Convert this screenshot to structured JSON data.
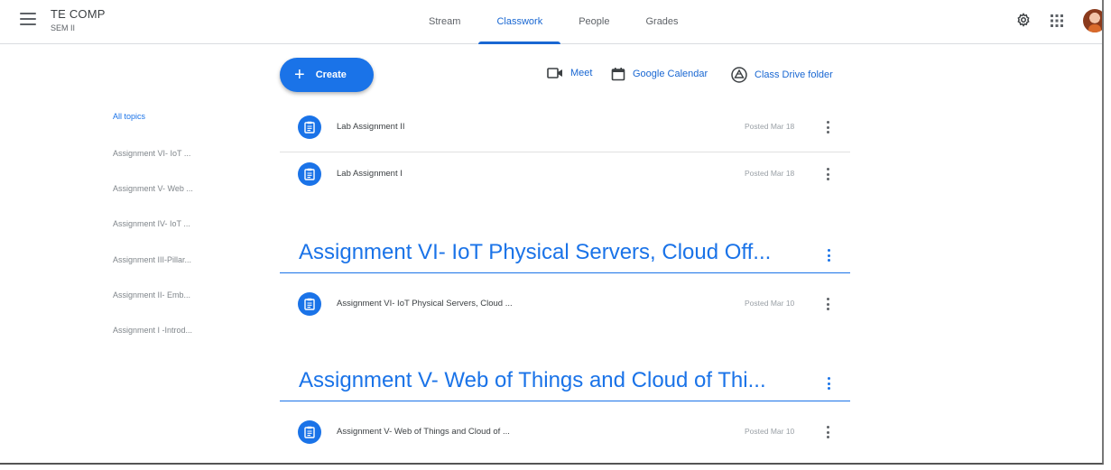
{
  "header": {
    "class_name": "TE COMP",
    "class_section": "SEM II",
    "tabs": [
      {
        "label": "Stream"
      },
      {
        "label": "Classwork"
      },
      {
        "label": "People"
      },
      {
        "label": "Grades"
      }
    ],
    "active_tab": "Classwork"
  },
  "toolbar": {
    "create_label": "Create",
    "meet_label": "Meet",
    "calendar_label": "Google Calendar",
    "drive_label": "Class Drive folder"
  },
  "sidebar": {
    "topics": [
      {
        "label": "All topics"
      },
      {
        "label": "Assignment VI- IoT ..."
      },
      {
        "label": "Assignment V- Web ..."
      },
      {
        "label": "Assignment IV- IoT ..."
      },
      {
        "label": "Assignment III-Pillar..."
      },
      {
        "label": "Assignment II- Emb..."
      },
      {
        "label": "Assignment I -Introd..."
      }
    ]
  },
  "ungrouped_items": [
    {
      "title": "Lab Assignment II",
      "posted": "Posted Mar 18"
    },
    {
      "title": "Lab Assignment I",
      "posted": "Posted Mar 18"
    }
  ],
  "topic_sections": [
    {
      "title": "Assignment VI- IoT Physical Servers, Cloud Off...",
      "items": [
        {
          "title": "Assignment VI- IoT Physical Servers, Cloud ...",
          "posted": "Posted Mar 10"
        }
      ]
    },
    {
      "title": "Assignment V- Web of Things and Cloud of Thi...",
      "items": [
        {
          "title": "Assignment V- Web of Things and Cloud of ...",
          "posted": "Posted Mar 10"
        }
      ]
    }
  ],
  "colors": {
    "accent": "#1a73e8",
    "active_tab": "#1967d2",
    "muted_text": "#80868b"
  }
}
